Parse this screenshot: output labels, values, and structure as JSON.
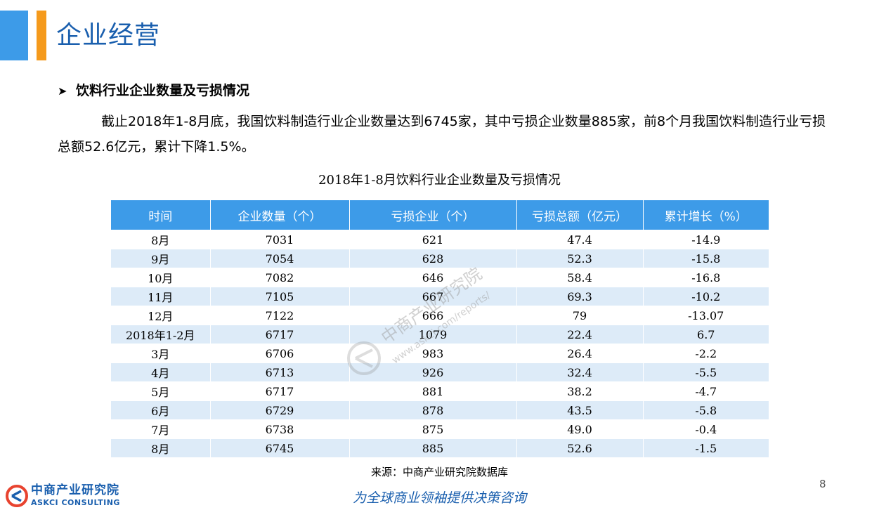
{
  "page": {
    "title": "企业经营",
    "section_heading": "饮料行业企业数量及亏损情况",
    "paragraph": "截止2018年1-8月底，我国饮料制造行业企业数量达到6745家，其中亏损企业数量885家，前8个月我国饮料制造行业亏损总额52.6亿元，累计下降1.5%。",
    "page_number": "8"
  },
  "table": {
    "title": "2018年1-8月饮料行业企业数量及亏损情况",
    "headers": [
      "时间",
      "企业数量（个）",
      "亏损企业（个）",
      "亏损总额（亿元）",
      "累计增长（%）"
    ],
    "rows": [
      [
        "8月",
        "7031",
        "621",
        "47.4",
        "-14.9"
      ],
      [
        "9月",
        "7054",
        "628",
        "52.3",
        "-15.8"
      ],
      [
        "10月",
        "7082",
        "646",
        "58.4",
        "-16.8"
      ],
      [
        "11月",
        "7105",
        "667",
        "69.3",
        "-10.2"
      ],
      [
        "12月",
        "7122",
        "666",
        "79",
        "-13.07"
      ],
      [
        "2018年1-2月",
        "6717",
        "1079",
        "22.4",
        "6.7"
      ],
      [
        "3月",
        "6706",
        "983",
        "26.4",
        "-2.2"
      ],
      [
        "4月",
        "6713",
        "926",
        "32.4",
        "-5.5"
      ],
      [
        "5月",
        "6717",
        "881",
        "38.2",
        "-4.7"
      ],
      [
        "6月",
        "6729",
        "878",
        "43.5",
        "-5.8"
      ],
      [
        "7月",
        "6738",
        "875",
        "49.0",
        "-0.4"
      ],
      [
        "8月",
        "6745",
        "885",
        "52.6",
        "-1.5"
      ]
    ],
    "source": "来源：中商产业研究院数据库"
  },
  "watermark": {
    "name": "中商产业研究院",
    "url": "www.askci.com/reports/"
  },
  "footer": {
    "logo_cn": "中商产业研究院",
    "logo_en": "ASKCI CONSULTING",
    "slogan": "为全球商业领袖提供决策咨询"
  },
  "colors": {
    "accent_blue": "#3d9be8",
    "accent_orange": "#f59a1c",
    "brand_blue": "#1a5fae",
    "row_alt": "#ddebf8"
  }
}
